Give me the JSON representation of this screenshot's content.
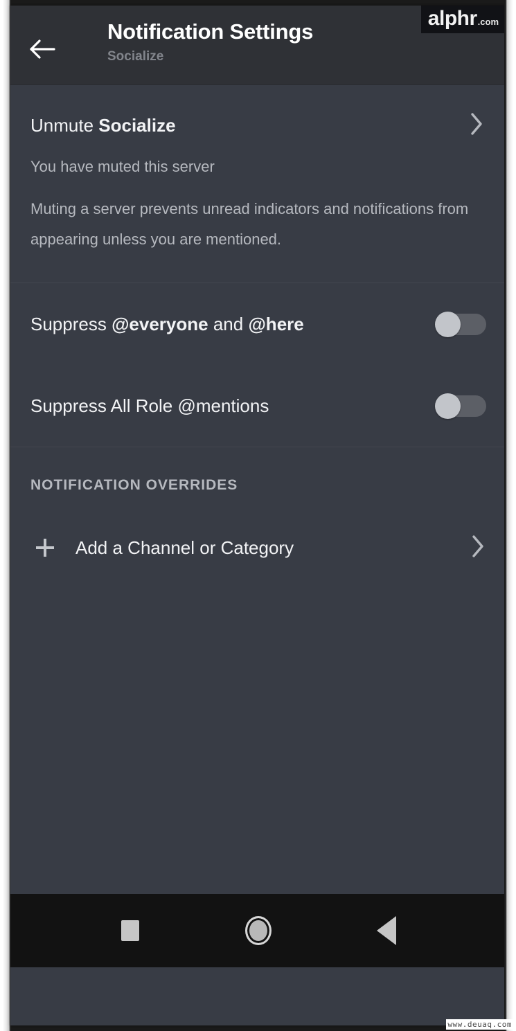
{
  "window": {
    "platform": "android",
    "background_color": "#383c45"
  },
  "watermarks": {
    "brand_main": "alphr",
    "brand_tld": ".com",
    "footer": "www.deuaq.com"
  },
  "header": {
    "back_icon": "arrow-left-icon",
    "title": "Notification Settings",
    "subtitle": "Socialize",
    "background_color": "#2f3136"
  },
  "mute_section": {
    "unmute_prefix": "Unmute ",
    "unmute_server": "Socialize",
    "chevron_icon": "chevron-right-icon",
    "status_text": "You have muted this server",
    "description": "Muting a server prevents unread indicators and notifications from appearing unless you are mentioned."
  },
  "suppress_section": {
    "rows": [
      {
        "label_prefix": "Suppress ",
        "label_bold_1": "@everyone",
        "label_middle": " and ",
        "label_bold_2": "@here",
        "toggle_state": "off",
        "toggle_name": "suppress-everyone-here-toggle"
      },
      {
        "label_full": "Suppress All Role @mentions",
        "toggle_state": "off",
        "toggle_name": "suppress-all-role-mentions-toggle"
      }
    ],
    "toggle_knob_color": "#c2c5ca",
    "toggle_track_color": "#5c5f66"
  },
  "overrides_section": {
    "header": "NOTIFICATION OVERRIDES",
    "add_icon": "plus-icon",
    "add_label": "Add a Channel or Category",
    "chevron_icon": "chevron-right-icon"
  },
  "navbar": {
    "recents_label": "recents-square",
    "home_label": "home-circle",
    "back_label": "back-triangle",
    "background_color": "#121212"
  }
}
